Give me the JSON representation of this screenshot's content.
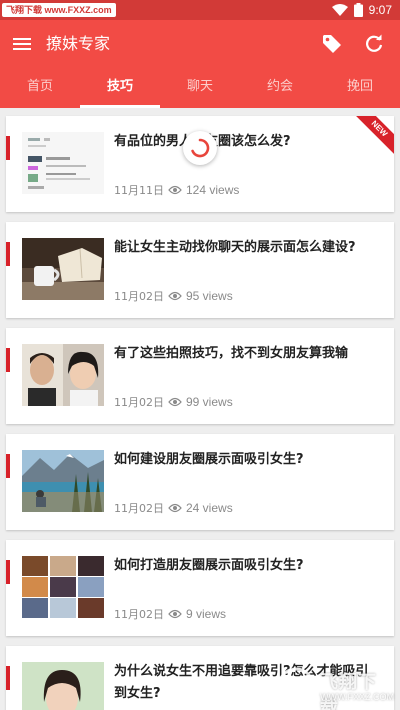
{
  "status_bar": {
    "watermark": "飞翔下载 www.FXXZ.com",
    "time": "9:07"
  },
  "toolbar": {
    "title": "撩妹专家",
    "menu_icon": "menu-icon",
    "tag_icon": "tag-icon",
    "refresh_icon": "refresh-icon"
  },
  "tabs": [
    {
      "label": "首页",
      "active": false
    },
    {
      "label": "技巧",
      "active": true
    },
    {
      "label": "聊天",
      "active": false
    },
    {
      "label": "约会",
      "active": false
    },
    {
      "label": "挽回",
      "active": false
    }
  ],
  "articles": [
    {
      "title": "有品位的男人朋友圈该怎么发?",
      "date": "11月11日",
      "views": "124 views",
      "badge": "NEW"
    },
    {
      "title": "能让女生主动找你聊天的展示面怎么建设?",
      "date": "11月02日",
      "views": "95 views"
    },
    {
      "title": "有了这些拍照技巧，找不到女朋友算我输",
      "date": "11月02日",
      "views": "99 views"
    },
    {
      "title": "如何建设朋友圈展示面吸引女生?",
      "date": "11月02日",
      "views": "24 views"
    },
    {
      "title": "如何打造朋友圈展示面吸引女生?",
      "date": "11月02日",
      "views": "9 views"
    },
    {
      "title": "为什么说女生不用追要靠吸引?怎么才能吸引到女生?",
      "date": "",
      "views": ""
    }
  ],
  "bottom_watermark": {
    "name": "飞翔下载",
    "url": "WWW.FXXZ.COM"
  },
  "colors": {
    "primary": "#f24b45",
    "status_bar": "#d23a37",
    "accent_bar": "#d8222a"
  }
}
